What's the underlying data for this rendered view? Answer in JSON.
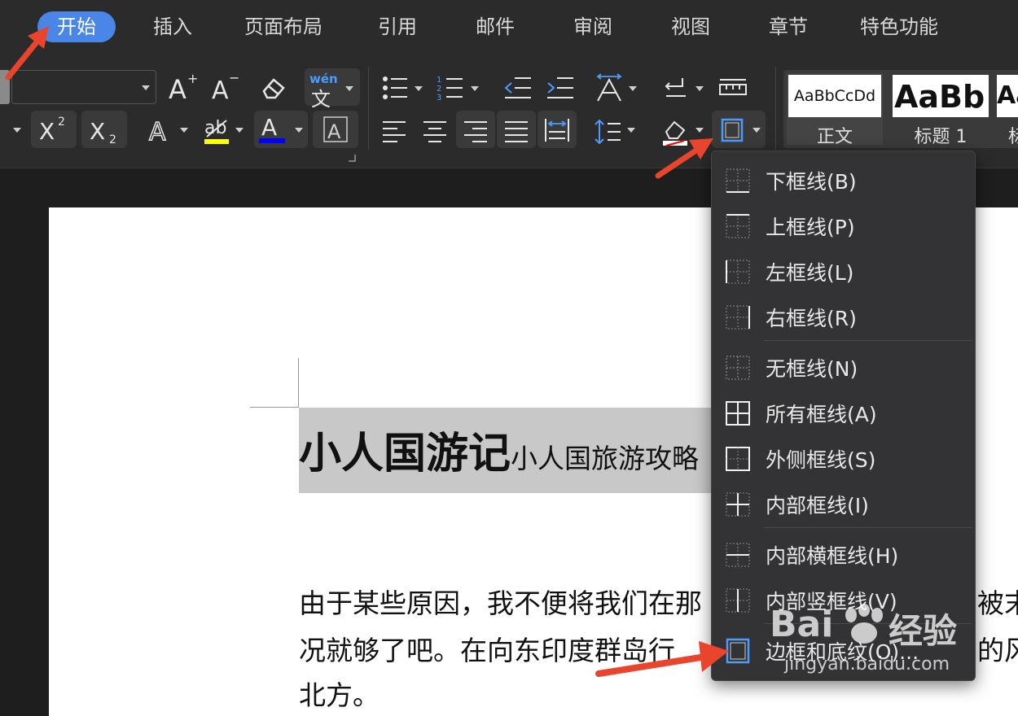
{
  "menu": {
    "tabs": [
      {
        "label": "开始",
        "active": true
      },
      {
        "label": "插入"
      },
      {
        "label": "页面布局"
      },
      {
        "label": "引用"
      },
      {
        "label": "邮件"
      },
      {
        "label": "审阅"
      },
      {
        "label": "视图"
      },
      {
        "label": "章节"
      },
      {
        "label": "特色功能"
      }
    ]
  },
  "ribbon": {
    "font_name_value": "",
    "pinyin_label": "wén",
    "styles": [
      {
        "preview": "AaBbCcDd",
        "label": "正文"
      },
      {
        "preview": "AaBb",
        "label": "标题 1"
      },
      {
        "preview": "Aa",
        "label": "标"
      }
    ],
    "colors": {
      "highlight": "#ffff00",
      "font_color": "#0000ff",
      "shading": "#ff0000"
    }
  },
  "document": {
    "title": "小人国游记",
    "subtitle": "小人国旅游攻略",
    "paragraph_lines": [
      "由于某些原因，我不便将我们在那",
      "况就够了吧。在向东印度群岛行",
      "北方。"
    ],
    "right_fragments": [
      "被末",
      "的风"
    ]
  },
  "border_menu": {
    "items": [
      {
        "label": "下框线(B)",
        "icon": "bottom-border-icon"
      },
      {
        "label": "上框线(P)",
        "icon": "top-border-icon"
      },
      {
        "label": "左框线(L)",
        "icon": "left-border-icon"
      },
      {
        "label": "右框线(R)",
        "icon": "right-border-icon"
      },
      {
        "label": "无框线(N)",
        "icon": "no-border-icon"
      },
      {
        "label": "所有框线(A)",
        "icon": "all-borders-icon"
      },
      {
        "label": "外侧框线(S)",
        "icon": "outside-borders-icon"
      },
      {
        "label": "内部框线(I)",
        "icon": "inside-borders-icon"
      },
      {
        "label": "内部横框线(H)",
        "icon": "inside-horizontal-border-icon"
      },
      {
        "label": "内部竖框线(V)",
        "icon": "inside-vertical-border-icon"
      },
      {
        "label": "边框和底纹(O)...",
        "icon": "borders-and-shading-icon"
      }
    ]
  },
  "watermark": {
    "brand": "Bai",
    "brand2": "经验",
    "url": "jingyan.baidu.com"
  }
}
